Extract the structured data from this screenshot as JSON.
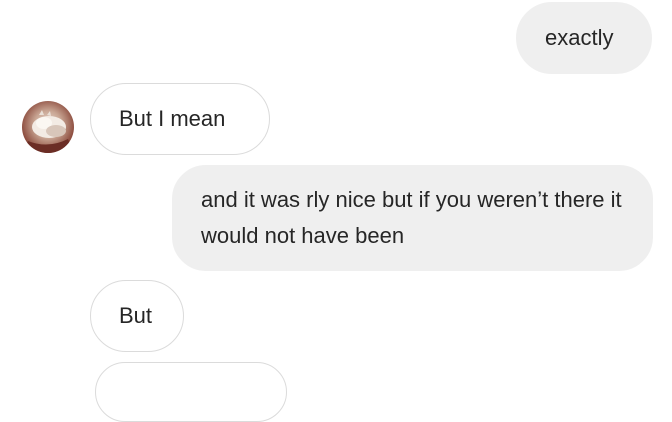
{
  "messages": [
    {
      "direction": "sent",
      "text": "exactly"
    },
    {
      "direction": "received",
      "text": "But I mean"
    },
    {
      "direction": "sent",
      "text": "and it was rly nice but if you weren’t there it would not have been"
    },
    {
      "direction": "received",
      "text": "But"
    },
    {
      "direction": "received",
      "text": ""
    }
  ],
  "contact": {
    "avatar": "avatar-photo"
  }
}
